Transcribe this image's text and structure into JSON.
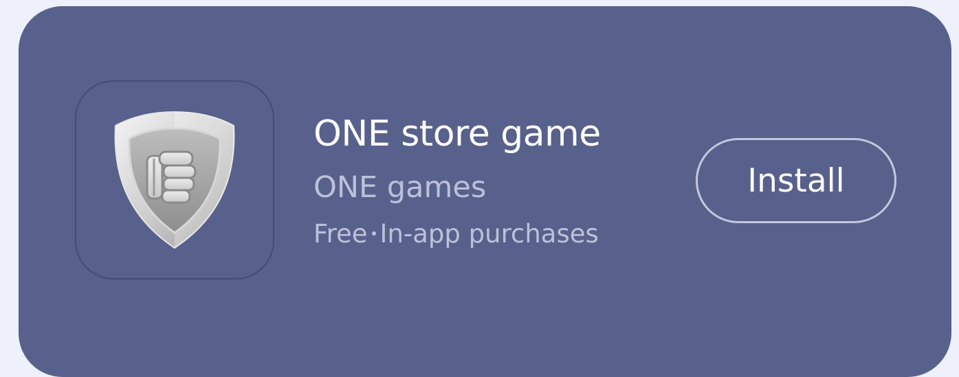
{
  "app": {
    "title": "ONE store game",
    "developer": "ONE games",
    "price": "Free",
    "purchase_note": "In-app purchases",
    "icon": "shield-fist-icon"
  },
  "actions": {
    "install_label": "Install"
  },
  "colors": {
    "page_background": "#eef0fb",
    "card_background": "#58618b",
    "title_text": "#ffffff",
    "secondary_text": "#bcc1db",
    "button_border": "#c4c8e0"
  }
}
